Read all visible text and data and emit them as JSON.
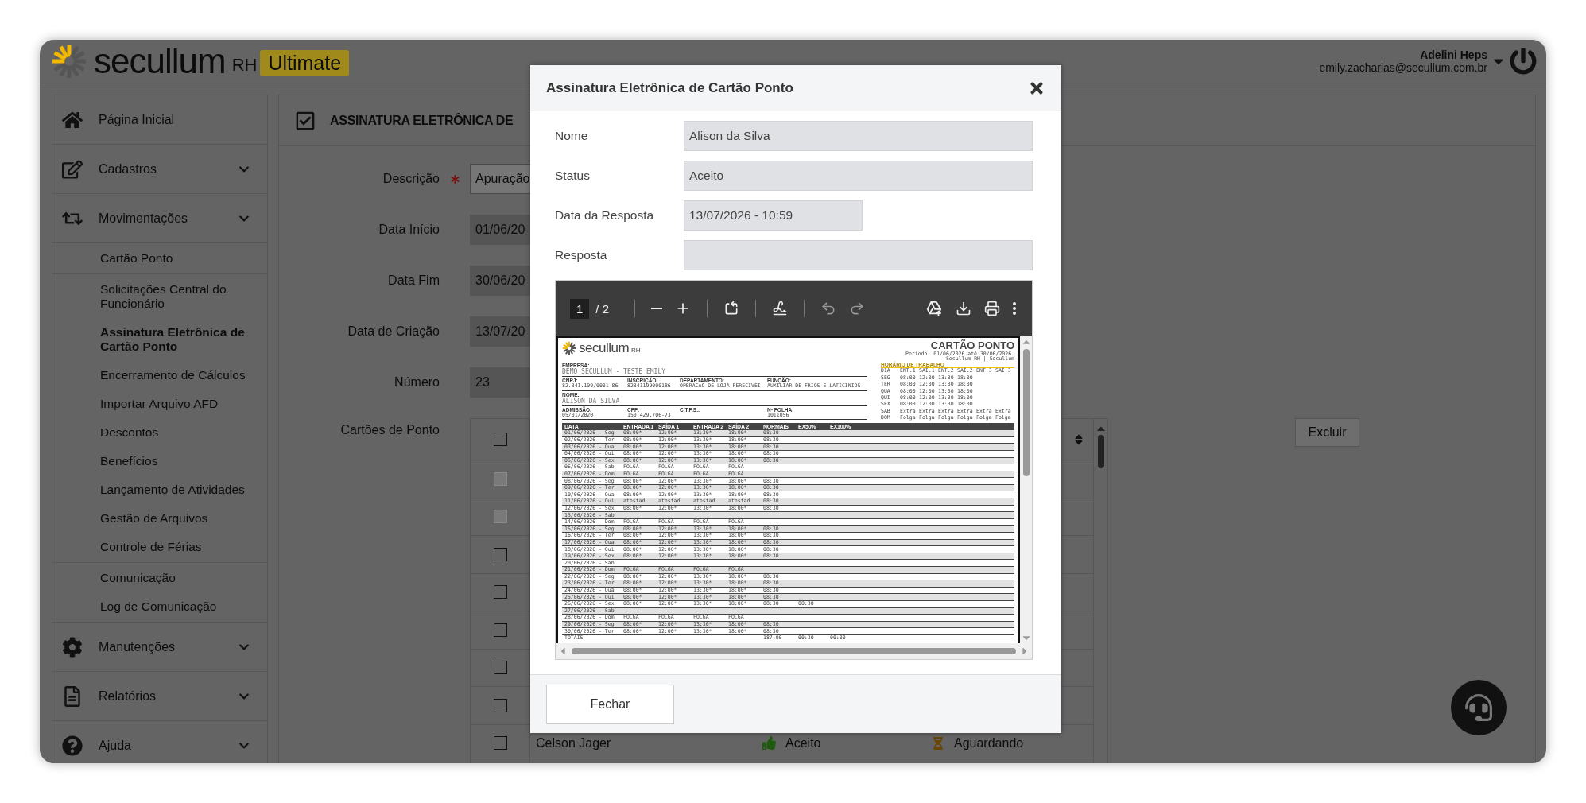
{
  "header": {
    "brand": "secullum",
    "brand_suffix": "RH",
    "edition": "Ultimate",
    "user_name": "Adelini Heps",
    "user_email": "emily.zacharias@secullum.com.br"
  },
  "sidebar": {
    "items": [
      {
        "label": "Página Inicial",
        "kind": "link"
      },
      {
        "label": "Cadastros",
        "kind": "group"
      },
      {
        "label": "Movimentações",
        "kind": "group",
        "groups": [
          {
            "items": [
              {
                "label": "Cartão Ponto",
                "selected": false
              }
            ]
          },
          {
            "items": [
              {
                "label": "Solicitações Central do Funcionário",
                "selected": false
              },
              {
                "label": "Assinatura Eletrônica de Cartão Ponto",
                "selected": true
              },
              {
                "label": "Encerramento de Cálculos",
                "selected": false
              },
              {
                "label": "Importar Arquivo AFD",
                "selected": false
              },
              {
                "label": "Descontos",
                "selected": false
              },
              {
                "label": "Benefícios",
                "selected": false
              },
              {
                "label": "Lançamento de Atividades",
                "selected": false
              },
              {
                "label": "Gestão de Arquivos",
                "selected": false
              },
              {
                "label": "Controle de Férias",
                "selected": false
              }
            ]
          },
          {
            "items": [
              {
                "label": "Comunicação",
                "selected": false
              },
              {
                "label": "Log de Comunicação",
                "selected": false
              }
            ]
          }
        ]
      },
      {
        "label": "Manutenções",
        "kind": "group"
      },
      {
        "label": "Relatórios",
        "kind": "group"
      },
      {
        "label": "Ajuda",
        "kind": "group"
      }
    ]
  },
  "page": {
    "title": "ASSINATURA ELETRÔNICA DE",
    "fields": [
      {
        "label": "Descrição",
        "required": true,
        "disabled": false,
        "value": "Apuração"
      },
      {
        "label": "Data Início",
        "required": false,
        "disabled": true,
        "value": "01/06/20"
      },
      {
        "label": "Data Fim",
        "required": false,
        "disabled": true,
        "value": "30/06/20"
      },
      {
        "label": "Data de Criação",
        "required": false,
        "disabled": true,
        "value": "13/07/20"
      },
      {
        "label": "Número",
        "required": false,
        "disabled": true,
        "value": "23"
      }
    ],
    "table_label": "Cartões de Ponto",
    "table": {
      "header_checked": false,
      "rows": [
        {
          "checked": false,
          "disabled": true
        },
        {
          "checked": false,
          "disabled": true
        },
        {
          "checked": false,
          "disabled": false
        },
        {
          "checked": false,
          "disabled": false
        },
        {
          "checked": false,
          "disabled": false
        },
        {
          "checked": false,
          "disabled": false
        },
        {
          "checked": false,
          "disabled": false
        },
        {
          "checked": false,
          "disabled": false,
          "column_2": "Celson Jager",
          "column_3": "Aceito",
          "column_4": "Aguardando"
        }
      ]
    },
    "delete_button": "Excluir"
  },
  "modal": {
    "title": "Assinatura Eletrônica de Cartão Ponto",
    "fields": [
      {
        "label": "Nome",
        "kind": "text",
        "value": "Alison da Silva"
      },
      {
        "label": "Status",
        "kind": "text",
        "value": "Aceito"
      },
      {
        "label": "Data da Resposta",
        "kind": "datetime",
        "value": "13/07/2026 - 10:59"
      },
      {
        "label": "Resposta",
        "kind": "text"
      }
    ],
    "pdf_viewer": {
      "page": "1",
      "page_count_label": "/ 2",
      "document": {
        "brand": "secullum",
        "brand_suffix": "RH",
        "title": "CARTÃO PONTO",
        "period": "Período: 01/06/2026 até 30/06/2026.",
        "source": "Secullum RH | Secullum",
        "info_rows": [
          {
            "kind": "wide",
            "fields": [
              {
                "label": "EMPRESA:",
                "value": "DEMO SECULLUM - TESTE EMILY"
              }
            ]
          },
          {
            "kind": "compact",
            "fields": [
              {
                "label": "CNPJ:",
                "value": "82.341.199/0001-86"
              },
              {
                "label": "INSCRIÇÃO:",
                "value": "82341199000186"
              },
              {
                "label": "DEPARTAMENTO:",
                "value": "OPERACAO DE LOJA PERECIVEI"
              },
              {
                "label": "FUNÇÃO:",
                "value": "AUXILIAR DE FRIOS E LATICINIOS"
              }
            ]
          },
          {
            "kind": "wide",
            "fields": [
              {
                "label": "NOME:",
                "value": "ALISON DA SILVA"
              }
            ]
          },
          {
            "kind": "compact",
            "fields": [
              {
                "label": "ADMISSÃO:",
                "value": "05/01/2020"
              },
              {
                "label": "CPF:",
                "value": "150.429.706-73"
              },
              {
                "label": "C.T.P.S.:"
              },
              {
                "label": "Nº FOLHA:",
                "value": "1011056"
              }
            ]
          }
        ],
        "schedule": {
          "title": "HORÁRIO DE TRABALHO",
          "columns": [
            "DIA",
            "ENT.1",
            "SAÍ.1",
            "ENT.2",
            "SAÍ.2",
            "ENT.3",
            "SAÍ.3"
          ],
          "rows": [
            [
              "SEG",
              "08:00",
              "12:00",
              "13:30",
              "18:00"
            ],
            [
              "TER",
              "08:00",
              "12:00",
              "13:30",
              "18:00"
            ],
            [
              "QUA",
              "08:00",
              "12:00",
              "13:30",
              "18:00"
            ],
            [
              "QUI",
              "08:00",
              "12:00",
              "13:30",
              "18:00"
            ],
            [
              "SEX",
              "08:00",
              "12:00",
              "13:30",
              "18:00"
            ],
            [
              "SAB",
              "Extra",
              "Extra",
              "Extra",
              "Extra",
              "Extra",
              "Extra"
            ],
            [
              "DOM",
              "Folga",
              "Folga",
              "Folga",
              "Folga",
              "Folga",
              "Folga"
            ]
          ]
        },
        "timesheet": {
          "columns": [
            "DATA",
            "ENTRADA 1",
            "SAÍDA 1",
            "ENTRADA 2",
            "SAÍDA 2",
            "NORMAIS",
            "EX50%",
            "EX100%"
          ],
          "rows": [
            [
              "01/06/2026 - Seg",
              "08:00*",
              "12:00*",
              "13:30*",
              "18:00*",
              "08:30"
            ],
            [
              "02/06/2026 - Ter",
              "08:00*",
              "12:00*",
              "13:30*",
              "18:00*",
              "08:30"
            ],
            [
              "03/06/2026 - Qua",
              "08:00*",
              "12:00*",
              "13:30*",
              "18:00*",
              "08:30"
            ],
            [
              "04/06/2026 - Qui",
              "08:00*",
              "12:00*",
              "13:30*",
              "18:00*",
              "08:30"
            ],
            [
              "05/06/2026 - Sex",
              "08:00*",
              "12:00*",
              "13:30*",
              "18:00*",
              "08:30"
            ],
            [
              "06/06/2026 - Sab",
              "FOLGA",
              "FOLGA",
              "FOLGA",
              "FOLGA"
            ],
            [
              "07/06/2026 - Dom",
              "FOLGA",
              "FOLGA",
              "FOLGA",
              "FOLGA"
            ],
            [
              "08/06/2026 - Seg",
              "08:00*",
              "12:00*",
              "13:30*",
              "18:00*",
              "08:30"
            ],
            [
              "09/06/2026 - Ter",
              "08:00*",
              "12:00*",
              "13:30*",
              "18:00*",
              "08:30"
            ],
            [
              "10/06/2026 - Qua",
              "08:00*",
              "12:00*",
              "13:30*",
              "18:00*",
              "08:30"
            ],
            [
              "11/06/2026 - Qui",
              "atestad",
              "atestad",
              "atestad",
              "atestad",
              "08:30"
            ],
            [
              "12/06/2026 - Sex",
              "08:00*",
              "12:00*",
              "13:30*",
              "18:00*",
              "08:30"
            ],
            [
              "13/06/2026 - Sab"
            ],
            [
              "14/06/2026 - Dom",
              "FOLGA",
              "FOLGA",
              "FOLGA",
              "FOLGA"
            ],
            [
              "15/06/2026 - Seg",
              "08:00*",
              "12:00*",
              "13:30*",
              "18:00*",
              "08:30"
            ],
            [
              "16/06/2026 - Ter",
              "08:00*",
              "12:00*",
              "13:30*",
              "18:00*",
              "08:30"
            ],
            [
              "17/06/2026 - Qua",
              "08:00*",
              "12:00*",
              "13:30*",
              "18:00*",
              "08:30"
            ],
            [
              "18/06/2026 - Qui",
              "08:00*",
              "12:00*",
              "13:30*",
              "18:00*",
              "08:30"
            ],
            [
              "19/06/2026 - Sex",
              "08:00*",
              "12:00*",
              "13:30*",
              "18:00*",
              "08:30"
            ],
            [
              "20/06/2026 - Sab"
            ],
            [
              "21/06/2026 - Dom",
              "FOLGA",
              "FOLGA",
              "FOLGA",
              "FOLGA"
            ],
            [
              "22/06/2026 - Seg",
              "08:00*",
              "12:00*",
              "13:30*",
              "18:00*",
              "08:30"
            ],
            [
              "23/06/2026 - Ter",
              "08:00*",
              "12:00*",
              "13:30*",
              "18:00*",
              "08:30"
            ],
            [
              "24/06/2026 - Qua",
              "08:00*",
              "12:00*",
              "13:30*",
              "18:00*",
              "08:30"
            ],
            [
              "25/06/2026 - Qui",
              "08:00*",
              "12:00*",
              "13:30*",
              "18:00*",
              "08:30"
            ],
            [
              "26/06/2026 - Sex",
              "08:00*",
              "12:00*",
              "13:30*",
              "18:00*",
              "08:30",
              "00:30"
            ],
            [
              "27/06/2026 - Sab"
            ],
            [
              "28/06/2026 - Dom",
              "FOLGA",
              "FOLGA",
              "FOLGA",
              "FOLGA"
            ],
            [
              "29/06/2026 - Seg",
              "08:00*",
              "12:00*",
              "13:30*",
              "18:00*",
              "08:30"
            ],
            [
              "30/06/2026 - Ter",
              "08:00*",
              "12:00*",
              "13:30*",
              "18:00*",
              "08:30"
            ]
          ],
          "totals": {
            "label": "TOTAIS",
            "values": [
              "187:00",
              "00:30",
              "00:00"
            ]
          }
        }
      }
    },
    "close_button": "Fechar"
  }
}
